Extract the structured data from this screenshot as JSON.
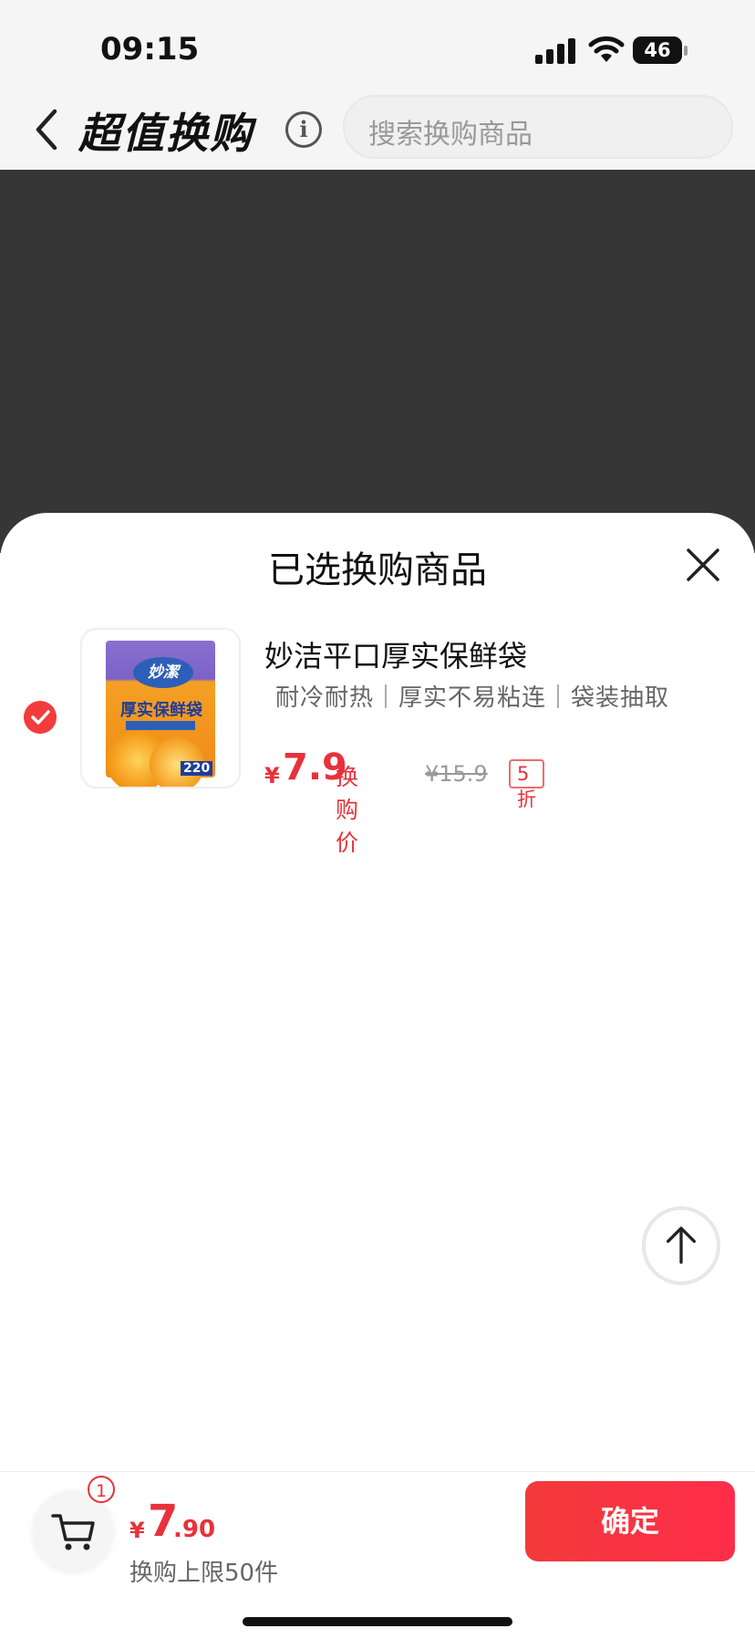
{
  "status_bar": {
    "time": "09:15",
    "battery": "46"
  },
  "header": {
    "title": "超值换购",
    "info_glyph": "i",
    "search_placeholder": "搜索换购商品"
  },
  "sheet": {
    "title": "已选换购商品",
    "items": [
      {
        "selected": true,
        "name": "妙洁平口厚实保鲜袋",
        "tags": "耐冷耐热｜厚实不易粘连｜袋装抽取",
        "currency": "¥",
        "price": "7.9",
        "price_label": "换购价",
        "original_price": "¥15.9",
        "discount": "5折",
        "image_text": {
          "brand": "妙潔",
          "title": "厚实保鲜袋",
          "count": "220"
        }
      }
    ]
  },
  "bottom_bar": {
    "cart_count": "1",
    "currency": "¥",
    "total_integer": "7",
    "total_decimal": ".90",
    "limit_text": "换购上限50件",
    "confirm_label": "确定"
  },
  "colors": {
    "accent": "#e8313b",
    "overlay": "#363636"
  },
  "icons": [
    "signal-icon",
    "wifi-icon",
    "battery-icon",
    "back-arrow-icon",
    "info-icon",
    "close-icon",
    "check-circle-icon",
    "arrow-up-icon",
    "cart-icon"
  ]
}
